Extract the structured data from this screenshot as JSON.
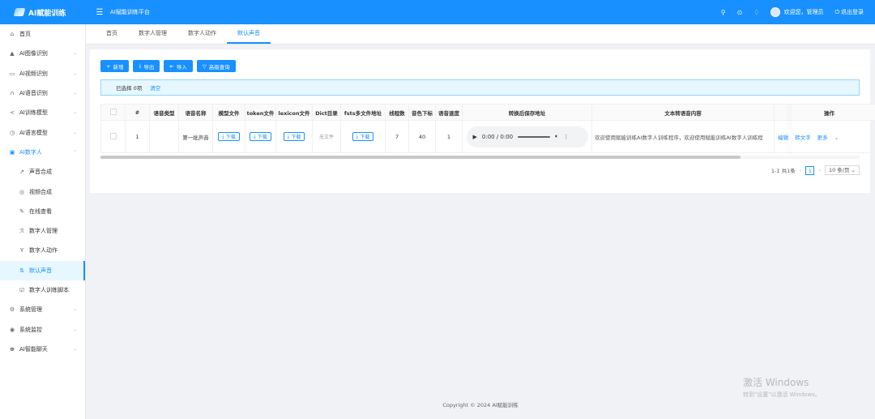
{
  "header": {
    "logo_text": "AI赋能训练",
    "platform_title": "AI赋能训练平台",
    "welcome_text": "欢迎您，管理员",
    "logout_label": "退出登录"
  },
  "sidebar": {
    "items": [
      {
        "label": "首页",
        "icon": "⌂"
      },
      {
        "label": "AI图像识别",
        "icon": "▲",
        "arrow": "⌄"
      },
      {
        "label": "AI视频识别",
        "icon": "▭",
        "arrow": "⌄"
      },
      {
        "label": "AI语音识别",
        "icon": "∩",
        "arrow": "⌄"
      },
      {
        "label": "AI训练模型",
        "icon": "<",
        "arrow": "⌄"
      },
      {
        "label": "AI语言模型",
        "icon": "◷",
        "arrow": "⌄"
      },
      {
        "label": "AI数字人",
        "icon": "▣",
        "arrow": "⌃"
      },
      {
        "label": "声音合成",
        "icon": "↗"
      },
      {
        "label": "视频合成",
        "icon": "◎"
      },
      {
        "label": "在线查看",
        "icon": "✎"
      },
      {
        "label": "数字人管理",
        "icon": "ℛ"
      },
      {
        "label": "数字人动作",
        "icon": "Y"
      },
      {
        "label": "默认声音",
        "icon": "⇅"
      },
      {
        "label": "数字人训练脚本",
        "icon": "☑"
      },
      {
        "label": "系统管理",
        "icon": "⚙",
        "arrow": "⌄"
      },
      {
        "label": "系统监控",
        "icon": "◉",
        "arrow": "⌄"
      },
      {
        "label": "AI智能聊天",
        "icon": "♚",
        "arrow": "⌄"
      }
    ]
  },
  "tabs": [
    {
      "label": "首页"
    },
    {
      "label": "数字人管理"
    },
    {
      "label": "数字人动作"
    },
    {
      "label": "默认声音"
    }
  ],
  "toolbar": {
    "add_label": "新增",
    "export_label": "导出",
    "import_label": "导入",
    "advanced_label": "高级查询"
  },
  "selection": {
    "selected_text": "已选择 0项",
    "clear_label": "清空"
  },
  "table": {
    "headers": [
      "#",
      "语音类型",
      "语音名称",
      "模型文件",
      "token文件",
      "lexicon文件",
      "Dict目录",
      "fsts多文件地址",
      "线程数",
      "音色下标",
      "语音速度",
      "转换后保存地址",
      "文本转语音内容",
      "操作"
    ],
    "rows": [
      {
        "index": "1",
        "voice_type": "",
        "voice_name": "第一批声音",
        "model_file": "下载",
        "token_file": "下载",
        "lexicon_file": "下载",
        "dict_dir": "无文件",
        "fsts": "下载",
        "threads": "7",
        "timbre": "40",
        "speed": "1",
        "audio_time": "0:00 / 0:00",
        "content": "欢迎使用赋能训练AI数字人训练程序，欢迎使用赋能训练AI数字人训练程",
        "op_edit": "编辑",
        "op_convert": "转文字",
        "op_more": "更多"
      }
    ]
  },
  "pagination": {
    "summary": "1-1 共1条",
    "current": "1",
    "page_size": "10 条/页"
  },
  "footer": {
    "copyright": "Copyright © 2024 AI赋能训练"
  },
  "watermark": {
    "title": "激活 Windows",
    "subtitle": "转到\"设置\"以激活 Windows。"
  },
  "colors": {
    "primary": "#1890ff",
    "active_bg": "#e6f7ff"
  }
}
